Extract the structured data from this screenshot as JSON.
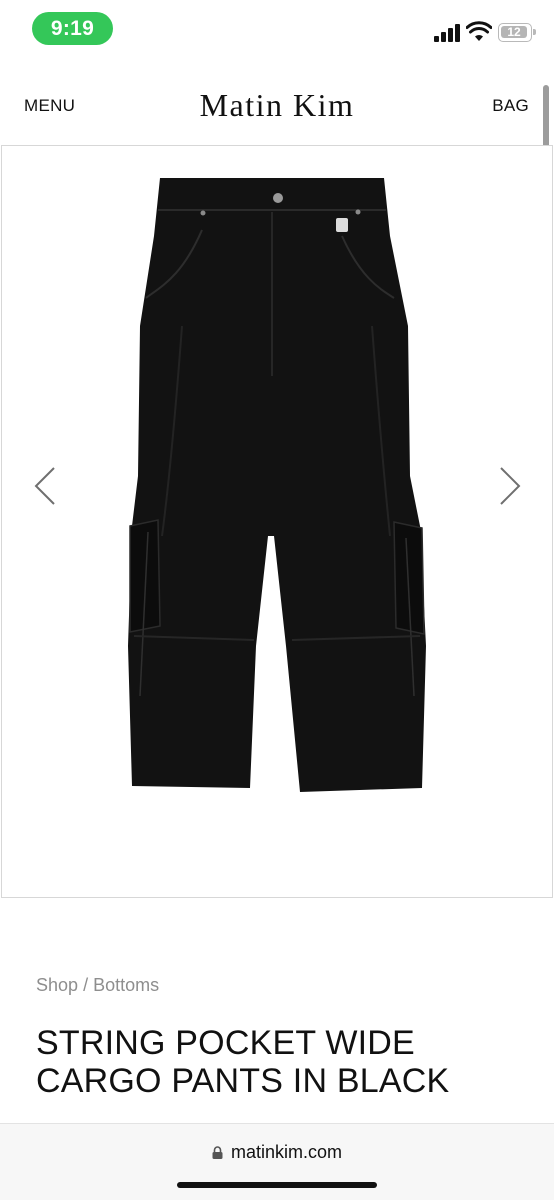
{
  "status_bar": {
    "time": "9:19",
    "battery_level": "12",
    "signal_bars": 4,
    "wifi": "full",
    "time_pill_color": "#34c759"
  },
  "header": {
    "menu_label": "MENU",
    "brand": "Matin Kim",
    "bag_label": "BAG"
  },
  "gallery": {
    "prev_icon": "chevron-left-icon",
    "next_icon": "chevron-right-icon",
    "product_color": "#111111"
  },
  "product": {
    "breadcrumb": {
      "shop": "Shop",
      "separator": "/",
      "category": "Bottoms"
    },
    "title_line1": "STRING POCKET WIDE",
    "title_line2": "CARGO PANTS IN BLACK"
  },
  "browser": {
    "url": "matinkim.com",
    "lock_icon": "lock-icon"
  }
}
